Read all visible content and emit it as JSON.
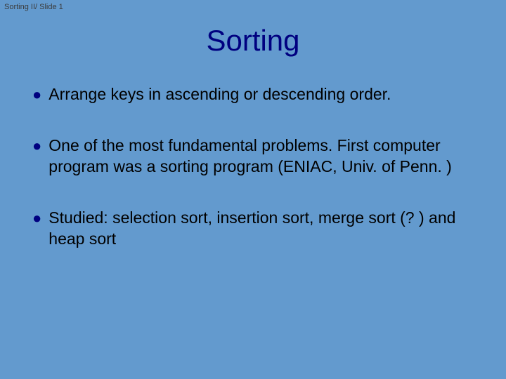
{
  "slide": {
    "meta": "Sorting II/ Slide 1",
    "title": "Sorting",
    "bullets": [
      "Arrange keys in ascending or descending order.",
      "One of the most fundamental problems. First computer program was a sorting program (ENIAC, Univ. of Penn. )",
      "Studied: selection sort, insertion sort, merge sort (? ) and heap sort"
    ]
  }
}
